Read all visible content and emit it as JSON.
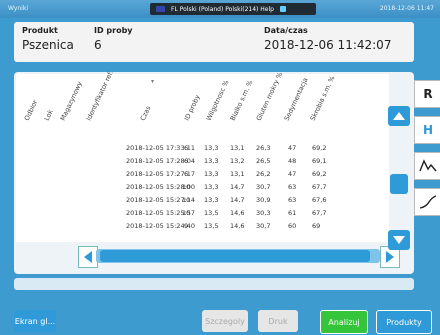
{
  "topbar": {
    "title": "Wyniki",
    "center": "FL Polski (Poland)   Polski(214)   Help",
    "time": "2018-12-06 11:47"
  },
  "header": {
    "produkt_label": "Produkt",
    "produkt_value": "Pszenica",
    "id_label": "ID proby",
    "id_value": "6",
    "data_label": "Data/czas",
    "data_value": "2018-12-06 11:42:07"
  },
  "table": {
    "columns": [
      "Odbior",
      "Lok",
      "Magazynowy",
      "Identyfikator ref.",
      "Czas",
      "ID proby",
      "Wilgotnosc %",
      "Bialko s.m. %",
      "Gluten mokry %",
      "Sedymentacja",
      "Skrobia s.m. %"
    ],
    "rows": [
      [
        "2018-12-05 17:33:11",
        "6",
        "13,3",
        "13,1",
        "26,3",
        "47",
        "69,2"
      ],
      [
        "2018-12-05 17:28:04",
        "6",
        "13,3",
        "13,2",
        "26,5",
        "48",
        "69,1"
      ],
      [
        "2018-12-05 17:27:17",
        "6",
        "13,3",
        "13,1",
        "26,2",
        "47",
        "69,2"
      ],
      [
        "2018-12-05 15:28:00",
        "10",
        "13,3",
        "14,7",
        "30,7",
        "63",
        "67,7"
      ],
      [
        "2018-12-05 15:27:14",
        "10",
        "13,3",
        "14,7",
        "30,9",
        "63",
        "67,6"
      ],
      [
        "2018-12-05 15:25:57",
        "10",
        "13,5",
        "14,6",
        "30,3",
        "61",
        "67,7"
      ],
      [
        "2018-12-05 15:24:40",
        "9",
        "13,5",
        "14,6",
        "30,7",
        "60",
        "69"
      ]
    ]
  },
  "tabs": [
    "R",
    "H"
  ],
  "footer": {
    "ekran": "Ekran gl...",
    "szczegoly": "Szczegoly",
    "druk": "Druk",
    "analizuj": "Analizuj",
    "produkty": "Produkty"
  }
}
